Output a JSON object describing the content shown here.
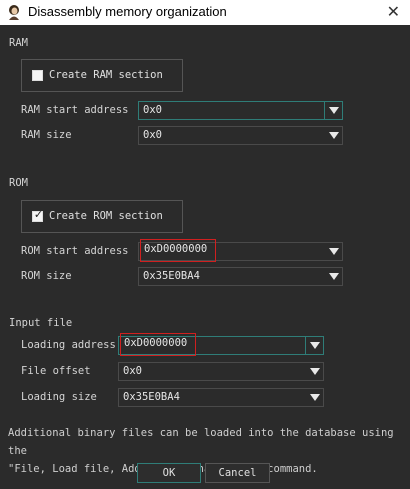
{
  "window": {
    "title": "Disassembly memory organization",
    "close_glyph": "✕",
    "app_icon": "person-icon"
  },
  "ram": {
    "section_label": "RAM",
    "create_label": "Create RAM section",
    "create_checked": false,
    "start_label": "RAM start address",
    "start_value": "0x0",
    "size_label": "RAM size",
    "size_value": "0x0"
  },
  "rom": {
    "section_label": "ROM",
    "create_label": "Create ROM section",
    "create_checked": true,
    "start_label": "ROM start address",
    "start_value": "0xD0000000",
    "size_label": "ROM size",
    "size_value": "0x35E0BA4"
  },
  "input": {
    "section_label": "Input file",
    "loading_label": "Loading address",
    "loading_value": "0xD0000000",
    "offset_label": "File offset",
    "offset_value": "0x0",
    "size_label": "Loading size",
    "size_value": "0x35E0BA4"
  },
  "info": {
    "line1": "Additional binary files can be loaded into the database using the",
    "line2": "\"File, Load file, Addtional binary file\" command."
  },
  "buttons": {
    "ok_label": "OK",
    "cancel_label": "Cancel"
  },
  "colors": {
    "background": "#2b2b2b",
    "focus_accent": "#2f7d78",
    "highlight_box": "#d02020"
  }
}
